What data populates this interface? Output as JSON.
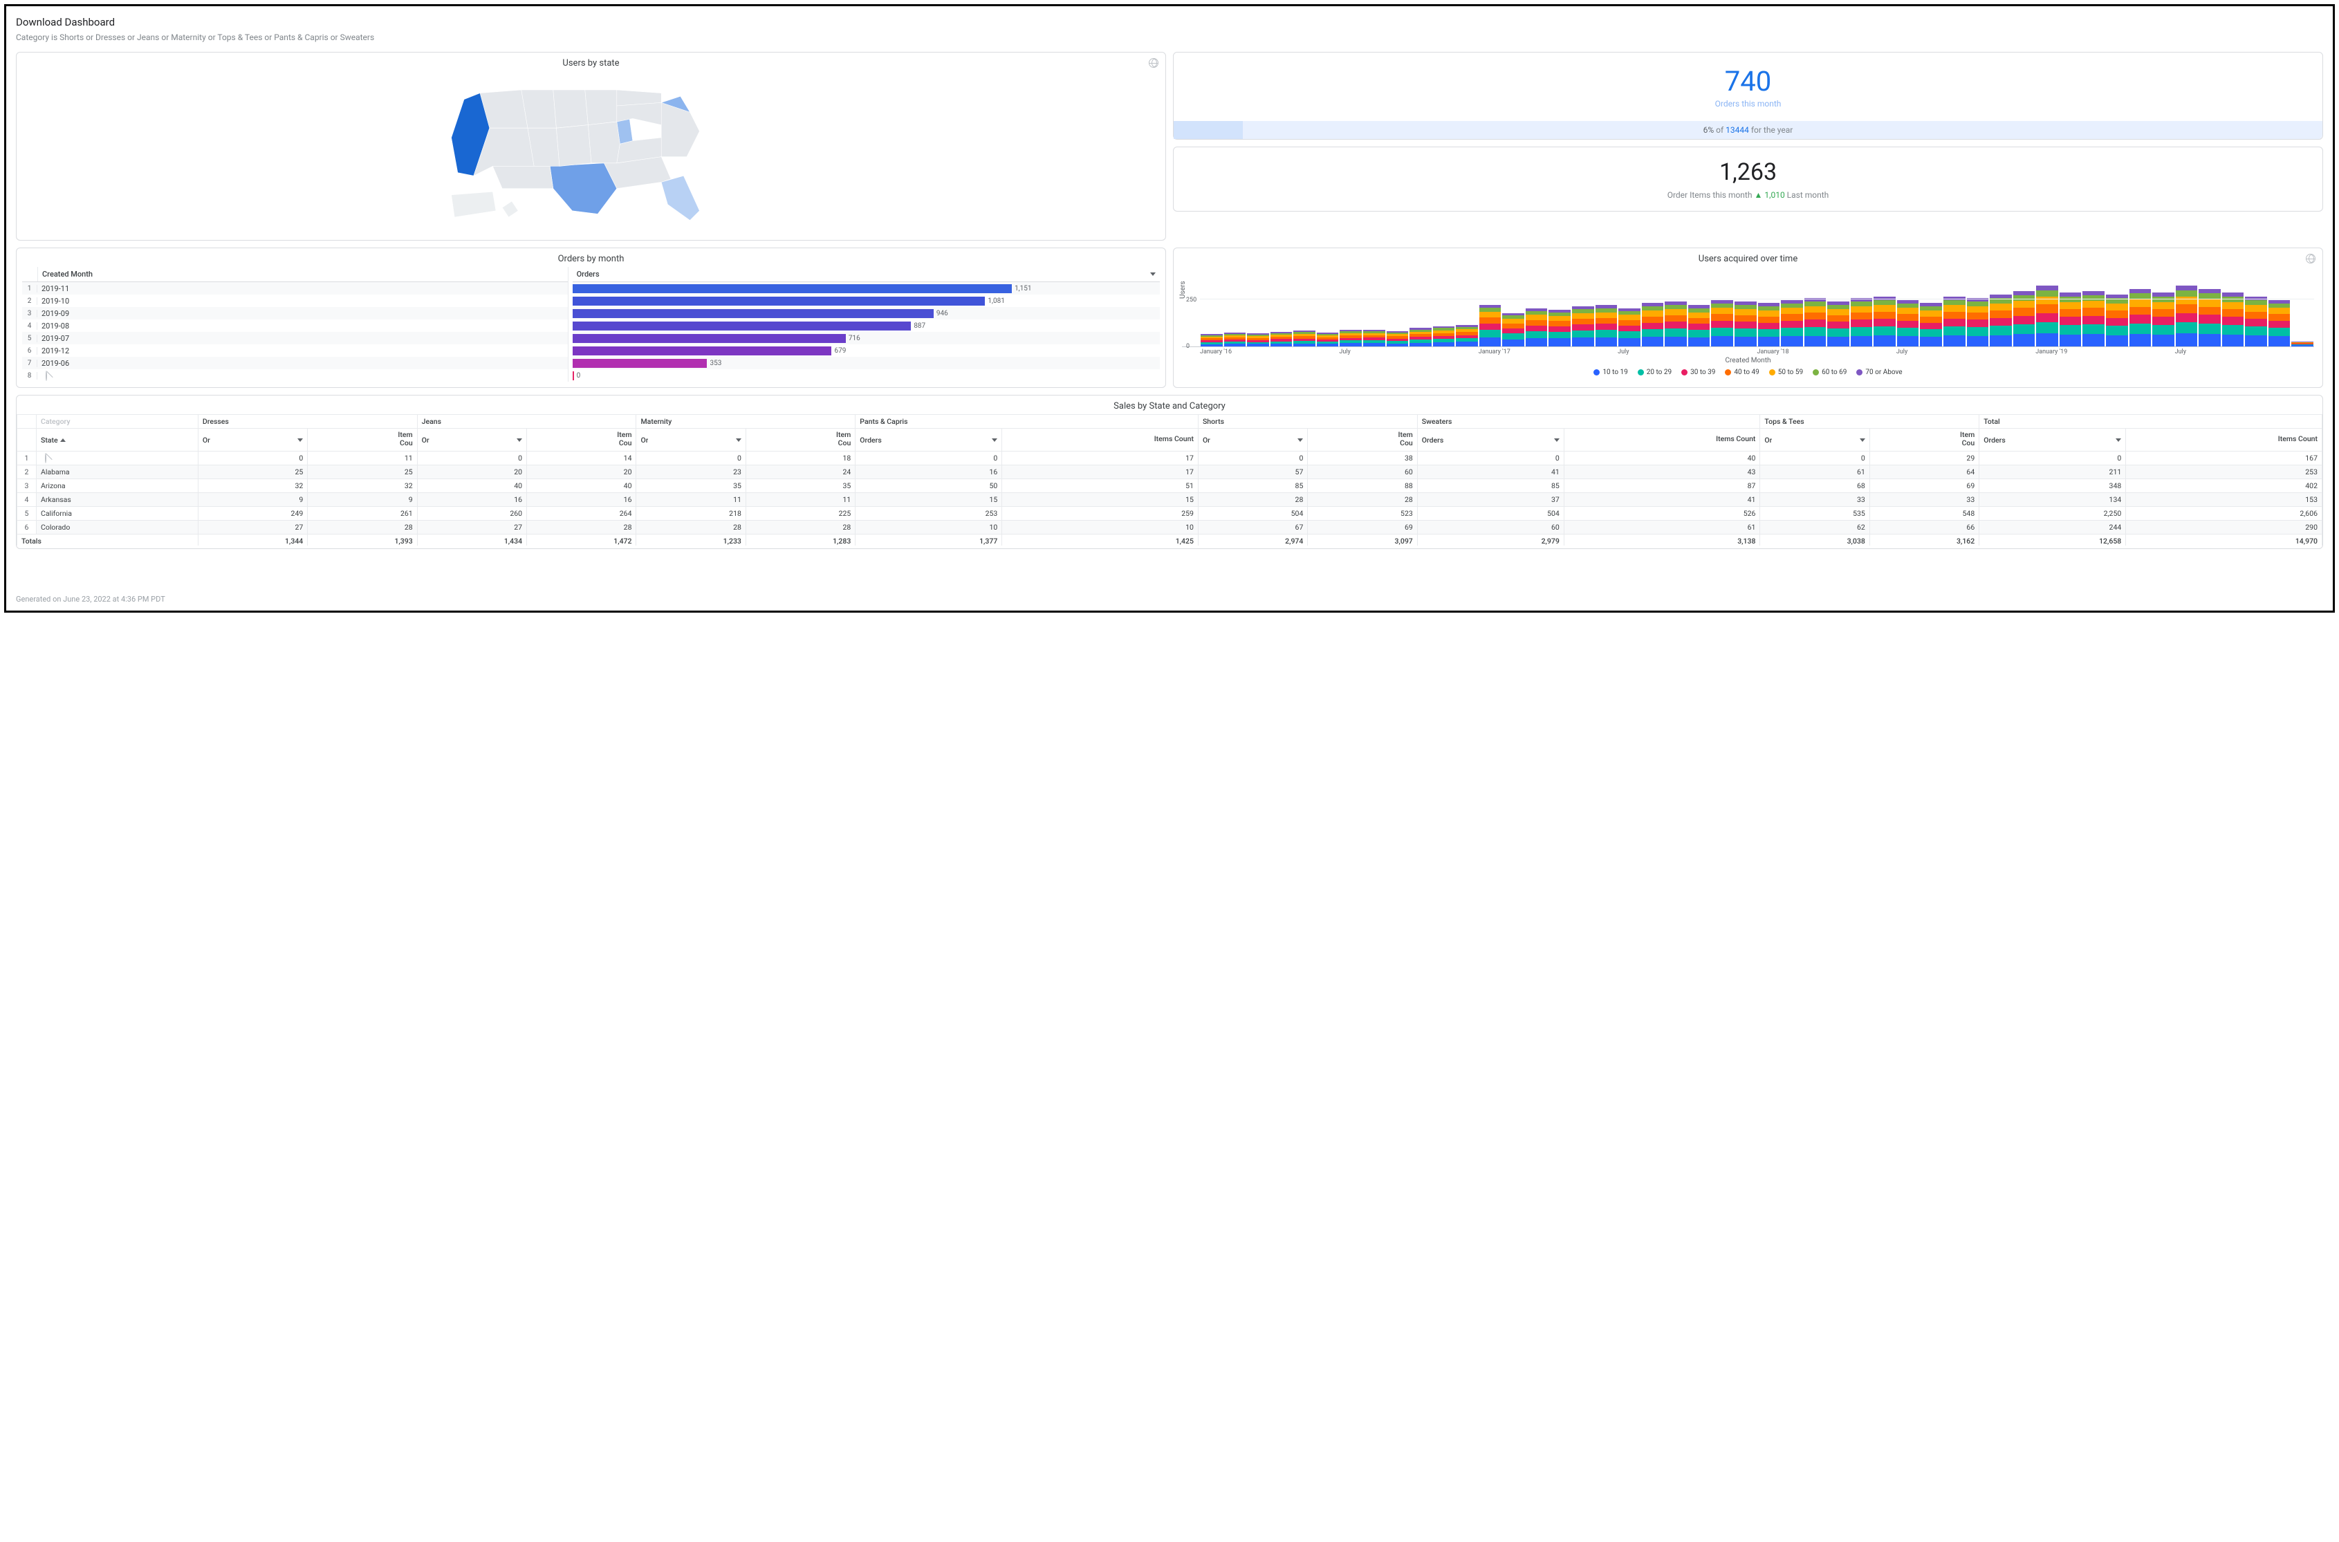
{
  "header": {
    "title": "Download Dashboard",
    "subtitle": "Category is Shorts or Dresses or Jeans or Maternity or Tops & Tees or Pants & Capris or Sweaters"
  },
  "tiles": {
    "map": {
      "title": "Users by state"
    },
    "kpi_orders": {
      "value": "740",
      "label": "Orders this month",
      "pct": "6%",
      "of": "of",
      "total": "13444",
      "suffix": "for the year"
    },
    "kpi_items": {
      "value": "1,263",
      "label_prefix": "Order Items this month",
      "delta": "1,010",
      "label_suffix": "Last month"
    },
    "orders_by_month": {
      "title": "Orders by month",
      "col_month": "Created Month",
      "col_orders": "Orders"
    },
    "users_acquired": {
      "title": "Users acquired over time",
      "ylabel": "Users",
      "xlabel": "Created Month"
    },
    "sales": {
      "title": "Sales by State and Category",
      "state_col": "State",
      "orders_col": "Orders",
      "items_col": "Items Count",
      "totals_label": "Totals",
      "category_label_partial": "Category"
    }
  },
  "legend": {
    "a": "10 to 19",
    "b": "20 to 29",
    "c": "30 to 39",
    "d": "40 to 49",
    "e": "50 to 59",
    "f": "60 to 69",
    "g": "70 or Above"
  },
  "footer": {
    "text": "Generated on June 23, 2022 at 4:36 PM PDT"
  },
  "chart_data": {
    "orders_by_month": {
      "type": "bar",
      "xlabel": "Orders",
      "ylabel": "Created Month",
      "rows": [
        {
          "idx": "1",
          "month": "2019-11",
          "orders": 1151,
          "color": "#3862e0"
        },
        {
          "idx": "2",
          "month": "2019-10",
          "orders": 1081,
          "color": "#4054d9"
        },
        {
          "idx": "3",
          "month": "2019-09",
          "orders": 946,
          "color": "#4a4fd4"
        },
        {
          "idx": "4",
          "month": "2019-08",
          "orders": 887,
          "color": "#5748cf"
        },
        {
          "idx": "5",
          "month": "2019-07",
          "orders": 716,
          "color": "#6a3ec9"
        },
        {
          "idx": "6",
          "month": "2019-12",
          "orders": 679,
          "color": "#7d36c2"
        },
        {
          "idx": "7",
          "month": "2019-06",
          "orders": 353,
          "color": "#b12fb0"
        },
        {
          "idx": "8",
          "month": "",
          "orders": 0,
          "color": "#e52566"
        }
      ],
      "max": 1200
    },
    "users_acquired": {
      "type": "bar",
      "stacked": true,
      "ylim": [
        0,
        400
      ],
      "yticks": [
        0,
        250
      ],
      "xticks": [
        "January '16",
        "July",
        "January '17",
        "July",
        "January '18",
        "July",
        "January '19",
        "July"
      ],
      "series_colors": {
        "10 to 19": "#2962ff",
        "20 to 29": "#00bfa5",
        "30 to 39": "#e91e63",
        "40 to 49": "#ff6d00",
        "50 to 59": "#ffab00",
        "60 to 69": "#7cb342",
        "70 or Above": "#7e57c2"
      },
      "columns": [
        [
          12,
          10,
          10,
          10,
          10,
          8,
          6
        ],
        [
          14,
          11,
          11,
          11,
          11,
          9,
          7
        ],
        [
          13,
          10,
          11,
          10,
          10,
          8,
          6
        ],
        [
          15,
          12,
          12,
          12,
          11,
          9,
          7
        ],
        [
          16,
          13,
          12,
          12,
          12,
          10,
          7
        ],
        [
          14,
          11,
          11,
          11,
          11,
          9,
          6
        ],
        [
          17,
          14,
          13,
          13,
          12,
          10,
          8
        ],
        [
          18,
          14,
          14,
          13,
          12,
          10,
          8
        ],
        [
          16,
          13,
          12,
          12,
          11,
          9,
          7
        ],
        [
          20,
          16,
          15,
          14,
          13,
          11,
          9
        ],
        [
          22,
          18,
          16,
          15,
          14,
          12,
          9
        ],
        [
          24,
          19,
          17,
          16,
          15,
          12,
          10
        ],
        [
          48,
          38,
          34,
          32,
          29,
          22,
          16
        ],
        [
          38,
          30,
          27,
          26,
          24,
          18,
          13
        ],
        [
          44,
          35,
          31,
          29,
          27,
          20,
          15
        ],
        [
          42,
          34,
          30,
          28,
          26,
          20,
          14
        ],
        [
          46,
          37,
          33,
          30,
          28,
          21,
          15
        ],
        [
          48,
          38,
          34,
          31,
          29,
          22,
          16
        ],
        [
          44,
          35,
          31,
          29,
          27,
          20,
          14
        ],
        [
          50,
          40,
          35,
          33,
          30,
          23,
          17
        ],
        [
          52,
          41,
          37,
          34,
          31,
          24,
          17
        ],
        [
          48,
          38,
          34,
          31,
          29,
          22,
          16
        ],
        [
          54,
          43,
          38,
          35,
          32,
          25,
          18
        ],
        [
          52,
          42,
          37,
          34,
          31,
          24,
          17
        ],
        [
          50,
          40,
          35,
          33,
          30,
          23,
          17
        ],
        [
          54,
          43,
          38,
          35,
          32,
          25,
          18
        ],
        [
          56,
          45,
          40,
          36,
          33,
          26,
          18
        ],
        [
          52,
          42,
          37,
          34,
          31,
          24,
          17
        ],
        [
          56,
          45,
          40,
          36,
          33,
          26,
          19
        ],
        [
          58,
          46,
          41,
          38,
          34,
          27,
          19
        ],
        [
          54,
          43,
          38,
          35,
          32,
          25,
          18
        ],
        [
          50,
          40,
          35,
          33,
          30,
          23,
          17
        ],
        [
          58,
          46,
          41,
          38,
          34,
          27,
          19
        ],
        [
          56,
          45,
          40,
          36,
          33,
          26,
          19
        ],
        [
          60,
          48,
          42,
          39,
          36,
          28,
          20
        ],
        [
          64,
          51,
          45,
          42,
          38,
          30,
          22
        ],
        [
          70,
          56,
          49,
          46,
          42,
          32,
          24
        ],
        [
          62,
          49,
          44,
          40,
          37,
          29,
          21
        ],
        [
          64,
          51,
          45,
          42,
          38,
          30,
          22
        ],
        [
          60,
          48,
          42,
          39,
          36,
          28,
          20
        ],
        [
          66,
          53,
          47,
          43,
          39,
          31,
          22
        ],
        [
          62,
          50,
          44,
          41,
          37,
          29,
          21
        ],
        [
          70,
          56,
          49,
          46,
          42,
          32,
          24
        ],
        [
          66,
          53,
          47,
          43,
          39,
          31,
          22
        ],
        [
          62,
          50,
          44,
          41,
          37,
          29,
          21
        ],
        [
          58,
          46,
          41,
          38,
          34,
          27,
          19
        ],
        [
          54,
          43,
          38,
          35,
          32,
          25,
          18
        ],
        [
          6,
          4,
          4,
          4,
          3,
          2,
          2
        ]
      ]
    },
    "users_by_state": {
      "type": "choropleth",
      "highlighted": {
        "CA": "high",
        "TX": "med",
        "NY": "med",
        "IL": "low",
        "FL": "low",
        "OH": "low",
        "PA": "low",
        "MI": "low",
        "NJ": "low",
        "MA": "low",
        "CT": "low"
      }
    }
  },
  "sales_table": {
    "categories": [
      "Dresses",
      "Jeans",
      "Maternity",
      "Pants & Capris",
      "Shorts",
      "Sweaters",
      "Tops & Tees",
      "Total"
    ],
    "rows": [
      {
        "idx": "1",
        "state": "",
        "d": [
          0,
          11,
          0,
          14,
          0,
          18,
          0,
          17,
          0,
          38,
          0,
          40,
          0,
          29,
          0,
          167
        ],
        "nodata": true
      },
      {
        "idx": "2",
        "state": "Alabama",
        "d": [
          25,
          25,
          20,
          20,
          23,
          24,
          16,
          17,
          57,
          60,
          41,
          43,
          61,
          64,
          211,
          253
        ]
      },
      {
        "idx": "3",
        "state": "Arizona",
        "d": [
          32,
          32,
          40,
          40,
          35,
          35,
          50,
          51,
          85,
          88,
          85,
          87,
          68,
          69,
          348,
          402
        ]
      },
      {
        "idx": "4",
        "state": "Arkansas",
        "d": [
          9,
          9,
          16,
          16,
          11,
          11,
          15,
          15,
          28,
          28,
          37,
          41,
          33,
          33,
          134,
          153
        ]
      },
      {
        "idx": "5",
        "state": "California",
        "d": [
          249,
          261,
          260,
          264,
          218,
          225,
          253,
          259,
          504,
          523,
          504,
          526,
          535,
          548,
          2250,
          2606
        ]
      },
      {
        "idx": "6",
        "state": "Colorado",
        "d": [
          27,
          28,
          27,
          28,
          28,
          28,
          10,
          10,
          67,
          69,
          60,
          61,
          62,
          66,
          244,
          290
        ]
      }
    ],
    "totals": [
      "1,344",
      "1,393",
      "1,434",
      "1,472",
      "1,233",
      "1,283",
      "1,377",
      "1,425",
      "2,974",
      "3,097",
      "2,979",
      "3,138",
      "3,038",
      "3,162",
      "12,658",
      "14,970"
    ]
  }
}
